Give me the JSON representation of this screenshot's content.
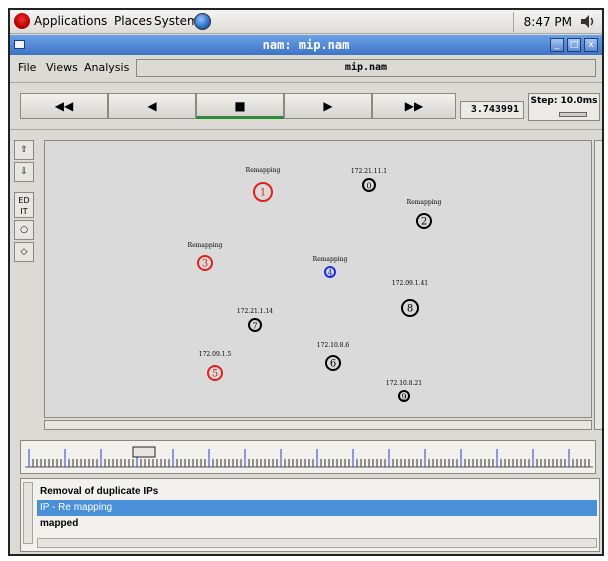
{
  "panel": {
    "menus": [
      "Applications",
      "Places",
      "System"
    ],
    "clock": "8:47 PM"
  },
  "window": {
    "title": "nam: mip.nam"
  },
  "menubar": {
    "file": "File",
    "views": "Views",
    "analysis": "Analysis",
    "filename": "mip.nam"
  },
  "playback": {
    "rewind": "◀◀",
    "back": "◀",
    "stop": "■",
    "play": "▶",
    "fast_forward": "▶▶",
    "time": "3.743991",
    "step": "Step: 10.0ms"
  },
  "tools": {
    "edit": "ED IT"
  },
  "nodes": [
    {
      "id": "1",
      "label": "Remapping",
      "color": "#e02020"
    },
    {
      "id": "0",
      "label": "172.21.11.1",
      "color": "#000000"
    },
    {
      "id": "2",
      "label": "Remapping",
      "color": "#000000"
    },
    {
      "id": "3",
      "label": "Remapping",
      "color": "#e02020"
    },
    {
      "id": "4",
      "label": "Remapping",
      "color": "#1a30e0"
    },
    {
      "id": "8",
      "label": "172.09.1.41",
      "color": "#000000"
    },
    {
      "id": "7",
      "label": "172.21.1.14",
      "color": "#000000"
    },
    {
      "id": "6",
      "label": "172.10.8.6",
      "color": "#000000"
    },
    {
      "id": "5",
      "label": "172.09.1.5",
      "color": "#e02020"
    },
    {
      "id": "9",
      "label": "172.10.8.21",
      "color": "#000000"
    }
  ],
  "annotations": [
    "Removal of duplicate IPs",
    "IP - Re mapping",
    "mapped"
  ],
  "colors": {
    "selection": "#4a8fd8",
    "titlebar": "#3f74c6",
    "progress": "#2e8a3a"
  }
}
